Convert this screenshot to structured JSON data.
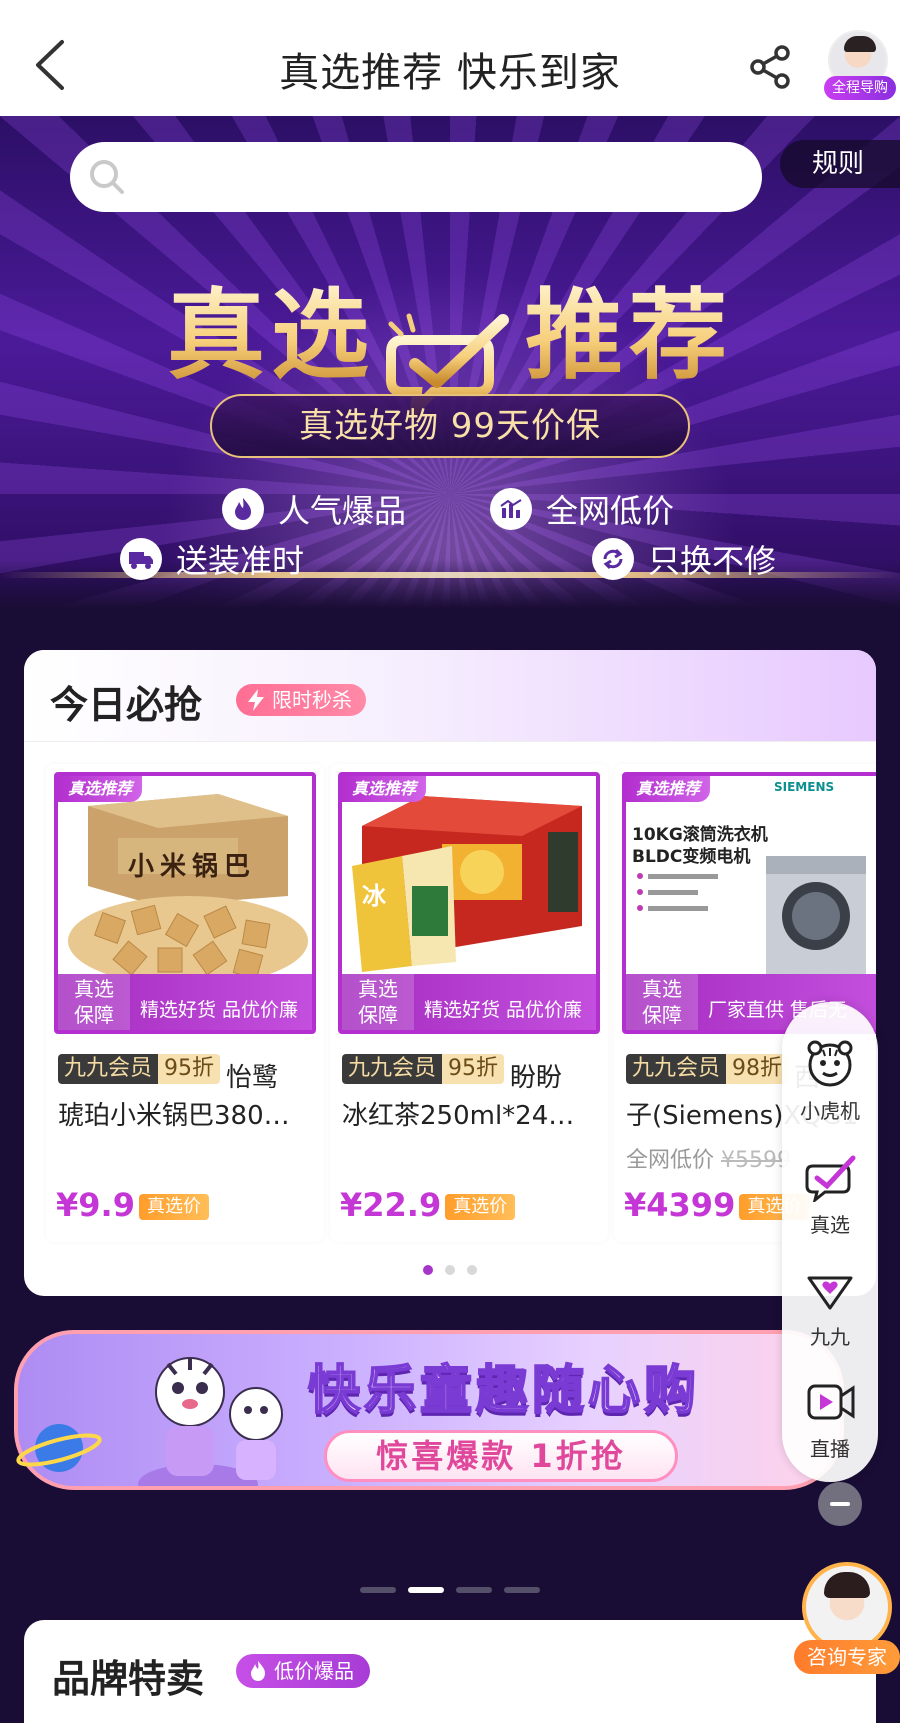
{
  "header": {
    "title": "真选推荐 快乐到家",
    "avatar_tag": "全程导购"
  },
  "hero": {
    "search_placeholder": "",
    "rules_label": "规则",
    "title_left": "真选",
    "title_right": "推荐",
    "pill_text": "真选好物  99天价保",
    "features": [
      "人气爆品",
      "全网低价",
      "送装准时",
      "只换不修"
    ]
  },
  "today": {
    "title": "今日必抢",
    "badge": "限时秒杀",
    "products": [
      {
        "brand_tag": "真选推荐",
        "guarantee_1": "真选",
        "guarantee_2": "保障",
        "slogan": "精选好货 品优价廉",
        "member_a": "九九会员",
        "member_b": "95折",
        "name_start": "怡鹭",
        "name_line2": "琥珀小米锅巴380…",
        "reference": "",
        "price": "¥9.9",
        "price_tag": "真选价",
        "box_text": "小米锅巴"
      },
      {
        "brand_tag": "真选推荐",
        "guarantee_1": "真选",
        "guarantee_2": "保障",
        "slogan": "精选好货 品优价廉",
        "member_a": "九九会员",
        "member_b": "95折",
        "name_start": "盼盼",
        "name_line2": "冰红茶250ml*24…",
        "reference": "",
        "price": "¥22.9",
        "price_tag": "真选价",
        "box_text": "冰"
      },
      {
        "brand_tag": "真选推荐",
        "guarantee_1": "真选",
        "guarantee_2": "保障",
        "slogan": "厂家直供 售后无",
        "member_a": "九九会员",
        "member_b": "98折",
        "name_start": "西",
        "name_line2": "子(Siemens)XQG1",
        "reference_label": "全网低价",
        "reference_price": "¥5599",
        "price": "¥4399",
        "price_tag": "真选价",
        "spec_line1": "10KG滚筒洗衣机",
        "spec_line2": "BLDC变频电机",
        "brand_logo": "SIEMENS"
      }
    ],
    "page_count": 3,
    "active_page": 1
  },
  "kids_banner": {
    "title": "快乐童趣随心购",
    "pill": "惊喜爆款 1折抢"
  },
  "carousel": {
    "count": 4,
    "active": 2
  },
  "brand": {
    "title": "品牌特卖",
    "badge": "低价爆品"
  },
  "side_rail": {
    "items": [
      {
        "label": "小虎机",
        "icon": "tiger-icon"
      },
      {
        "label": "真选",
        "icon": "check-badge-icon"
      },
      {
        "label": "九九",
        "icon": "heart-badge-icon"
      },
      {
        "label": "直播",
        "icon": "live-play-icon"
      }
    ]
  },
  "consult": {
    "label": "咨询专家"
  },
  "colors": {
    "accent_purple": "#a536c9",
    "price_purple": "#c536d6",
    "gold": "#f6cf7a",
    "hero_bg": "#2c0f66"
  }
}
